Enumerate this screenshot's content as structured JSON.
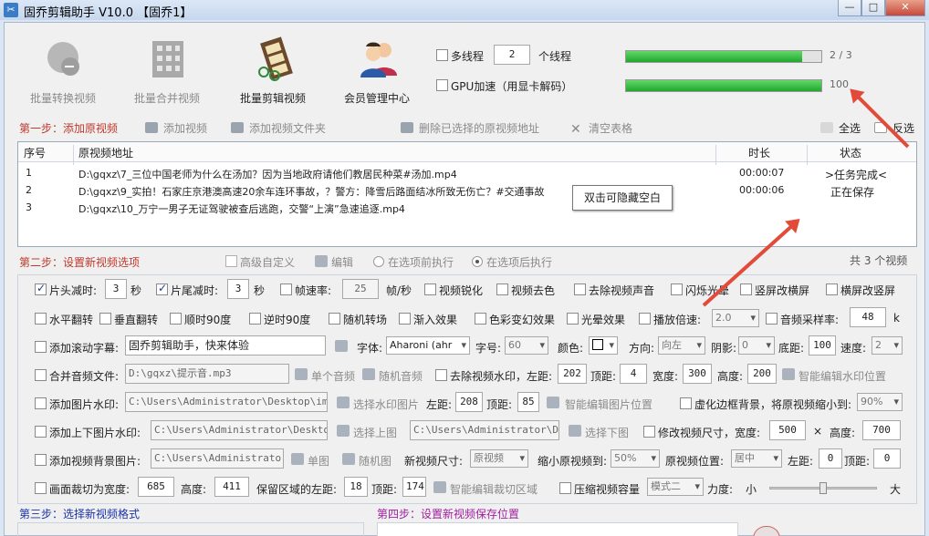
{
  "window": {
    "title": "固乔剪辑助手 V10.0  【固乔1】"
  },
  "toolbar": {
    "batch_convert": "批量转换视频",
    "batch_merge": "批量合并视频",
    "batch_edit": "批量剪辑视频",
    "member": "会员管理中心"
  },
  "threads": {
    "label": "多线程",
    "value": "2",
    "unit": "个线程",
    "gpu_label": "GPU加速（用显卡解码）"
  },
  "progress": {
    "bar1_text": "2 / 3",
    "bar1_fraction": 0.9,
    "bar2_text": "100",
    "bar2_fraction": 1.0
  },
  "step1": {
    "title": "第一步：添加原视频",
    "add_video": "添加视频",
    "add_folder": "添加视频文件夹",
    "delete_selected": "删除已选择的原视频地址",
    "clear_table": "清空表格",
    "select_all": "全选",
    "invert": "反选"
  },
  "table": {
    "headers": [
      "序号",
      "原视频地址",
      "时长",
      "状态"
    ],
    "rows": [
      {
        "no": "1",
        "path": "D:\\gqxz\\7_三位中国老师为什么在汤加？因为当地政府请他们教居民种菜#汤加.mp4",
        "duration": "00:00:07",
        "status": ">任务完成<"
      },
      {
        "no": "2",
        "path": "D:\\gqxz\\9_实拍！石家庄京港澳高速20余车连环事故，？警方：降雪后路面结冰所致无伤亡？#交通事故",
        "duration": "00:00:06",
        "status": "正在保存"
      },
      {
        "no": "3",
        "path": "D:\\gqxz\\10_万宁一男子无证驾驶被查后逃跑，交警“上演”急速追逐.mp4",
        "duration": "",
        "status": ""
      }
    ],
    "tooltip": "双击可隐藏空白"
  },
  "step2": {
    "title": "第二步：设置新视频选项",
    "advanced": "高级自定义",
    "edit": "编辑",
    "before": "在选项前执行",
    "after": "在选项后执行",
    "count": "共 3 个视频"
  },
  "opts": {
    "head_cut": "片头减时:",
    "head_val": "3",
    "sec1": "秒",
    "tail_cut": "片尾减时:",
    "tail_val": "3",
    "sec2": "秒",
    "fps": "帧速率:",
    "fps_val": "25",
    "fps_unit": "帧/秒",
    "sharpen": "视频锐化",
    "decolor": "视频去色",
    "mute": "去除视频声音",
    "flash": "闪烁光晕",
    "v2h": "竖屏改横屏",
    "h2v": "横屏改竖屏",
    "hflip": "水平翻转",
    "vflip": "垂直翻转",
    "rot90cw": "顺时90度",
    "rot90ccw": "逆时90度",
    "rand_trans": "随机转场",
    "fadein": "渐入效果",
    "color": "色彩变幻效果",
    "halo": "光晕效果",
    "speed": "播放倍速:",
    "speed_val": "2.0",
    "samplerate": "音频采样率:",
    "sr_val": "48",
    "sr_unit": "k",
    "scroll": "添加滚动字幕:",
    "scroll_text": "固乔剪辑助手，快来体验",
    "font": "字体:",
    "font_val": "Aharoni (ahr",
    "fontsize": "字号:",
    "fontsize_val": "60",
    "fcolor": "颜色:",
    "dir": "方向:",
    "dir_val": "向左",
    "shadow": "阴影:",
    "shadow_val": "0",
    "bottom": "底距:",
    "bottom_val": "100",
    "spd": "速度:",
    "spd_val": "2",
    "merge_audio": "合并音频文件:",
    "audio_path": "D:\\gqxz\\提示音.mp3",
    "single_audio": "单个音频",
    "rand_audio": "随机音频",
    "rm_wm": "去除视频水印，左距:",
    "wm_left": "202",
    "wm_top_lbl": "顶距:",
    "wm_top": "4",
    "wm_w_lbl": "宽度:",
    "wm_w": "300",
    "wm_h_lbl": "高度:",
    "wm_h": "200",
    "smart_wm": "智能编辑水印位置",
    "img_wm": "添加图片水印:",
    "img_wm_path": "C:\\Users\\Administrator\\Desktop\\img-q",
    "pick_wm": "选择水印图片",
    "iw_left_lbl": "左距:",
    "iw_left": "208",
    "iw_top_lbl": "顶距:",
    "iw_top": "85",
    "smart_img": "智能编辑图片位置",
    "blur_bg": "虚化边框背景，将原视频缩小到:",
    "blur_val": "90%",
    "tb_img": "添加上下图片水印:",
    "tb_path1": "C:\\Users\\Administrator\\Desktop\\i",
    "pick_top": "选择上图",
    "tb_path2": "C:\\Users\\Administrator\\Desk",
    "pick_bottom": "选择下图",
    "resize": "修改视频尺寸，宽度:",
    "rs_w": "500",
    "times": "×",
    "rs_h_lbl": "高度:",
    "rs_h": "700",
    "bg_img": "添加视频背景图片:",
    "bg_path": "C:\\Users\\Administrator\\D",
    "single_img": "单图",
    "rand_img": "随机图",
    "new_size": "新视频尺寸:",
    "new_size_val": "原视频",
    "shrink": "缩小原视频到:",
    "shrink_val": "50%",
    "pos": "原视频位置:",
    "pos_val": "居中",
    "p_left_lbl": "左距:",
    "p_left": "0",
    "p_top_lbl": "顶距:",
    "p_top": "0",
    "crop": "画面裁切为宽度:",
    "crop_w": "685",
    "crop_h_lbl": "高度:",
    "crop_h": "411",
    "keep_left": "保留区域的左距:",
    "keep_left_val": "18",
    "keep_top_lbl": "顶距:",
    "keep_top": "174",
    "smart_crop": "智能编辑裁切区域",
    "compress": "压缩视频容量",
    "mode_val": "模式二",
    "strength": "力度:",
    "small": "小",
    "large": "大"
  },
  "step3": {
    "title": "第三步：选择新视频格式"
  },
  "step4": {
    "title": "第四步：设置新视频保存位置"
  },
  "colors": {
    "accent_red": "#c0392b",
    "step_blue": "#1a33a8",
    "step4_purple": "#a020a0",
    "progress_green": "#1fa82c",
    "arrow_red": "#e24b3a"
  }
}
